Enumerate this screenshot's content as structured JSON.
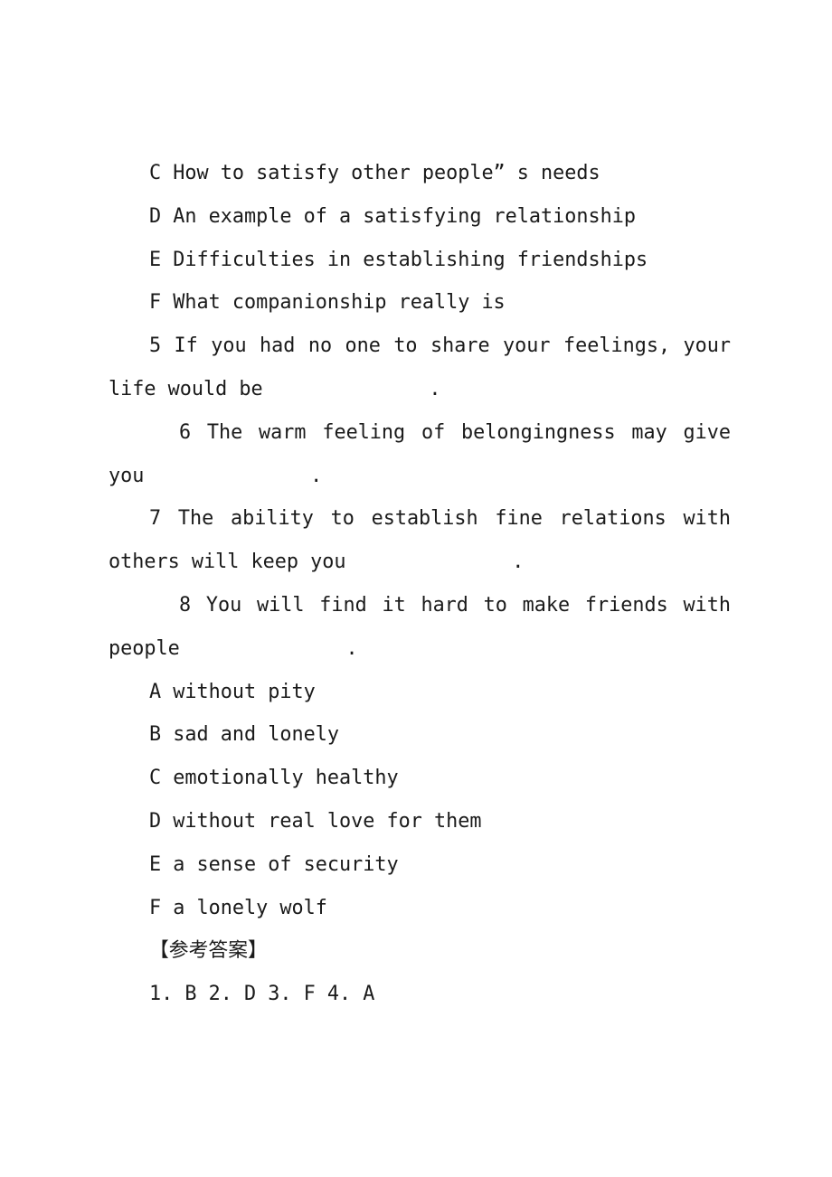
{
  "document": {
    "page_background": "#ffffff",
    "text_color": "#1a1a1a",
    "heading_topic_options": [
      {
        "letter": "C",
        "text": "C How to satisfy other people” s needs"
      },
      {
        "letter": "D",
        "text": "D An example of a satisfying relationship"
      },
      {
        "letter": "E",
        "text": "E Difficulties in establishing friendships"
      },
      {
        "letter": "F",
        "text": "F What companionship really is"
      }
    ],
    "questions": [
      {
        "number": "5",
        "text_before_blank": "5 If you had no one to share your feelings, your life would be",
        "blank": "              ",
        "terminator": "."
      },
      {
        "number": "6",
        "text_before_blank": "6 The warm feeling of belongingness may give you",
        "blank": "              ",
        "terminator": "."
      },
      {
        "number": "7",
        "text_before_blank": "7 The ability to establish fine relations with others will keep you",
        "blank": "              ",
        "terminator": "."
      },
      {
        "number": "8",
        "text_before_blank": "8 You will find it hard to make friends with people",
        "blank": "              ",
        "terminator": "."
      }
    ],
    "answer_options": [
      {
        "letter": "A",
        "text": "A without pity"
      },
      {
        "letter": "B",
        "text": "B sad and lonely"
      },
      {
        "letter": "C",
        "text": "C emotionally healthy"
      },
      {
        "letter": "D",
        "text": "D without real love for them"
      },
      {
        "letter": "E",
        "text": "E a sense of security"
      },
      {
        "letter": "F",
        "text": "F a lonely wolf"
      }
    ],
    "answer_key": {
      "heading": "【参考答案】",
      "answers": "1. B 2. D 3. F 4. A"
    }
  }
}
